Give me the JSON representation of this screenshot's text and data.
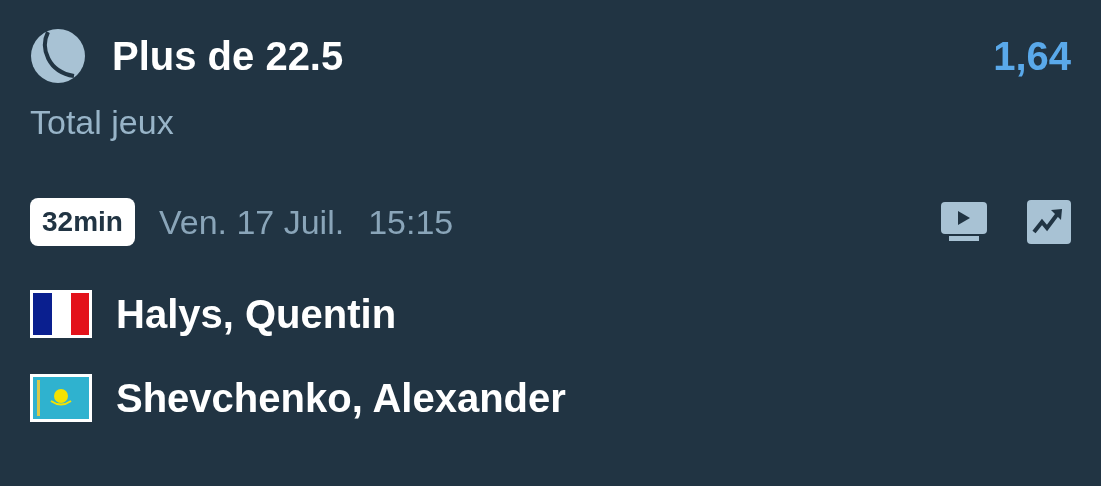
{
  "bet": {
    "title": "Plus de 22.5",
    "odds": "1,64",
    "market": "Total jeux"
  },
  "event": {
    "badge": "32min",
    "date": "Ven. 17 Juil.",
    "time": "15:15"
  },
  "players": [
    {
      "name": "Halys, Quentin",
      "kind": "fr"
    },
    {
      "name": "Shevchenko, Alexander",
      "kind": "kz"
    }
  ]
}
